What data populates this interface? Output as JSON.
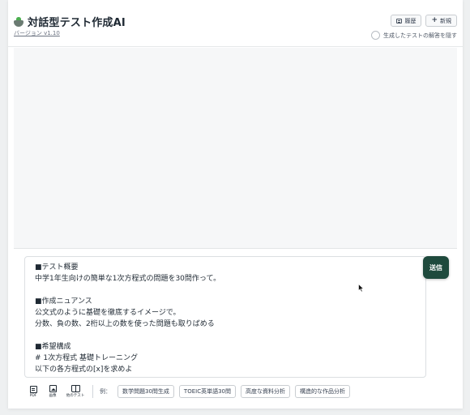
{
  "header": {
    "title": "対話型テスト作成AI",
    "version": "バージョン v1.10",
    "history_label": "履歴",
    "new_label": "新規",
    "hide_answers_label": "生成したテストの解答を隠す"
  },
  "composer": {
    "text": "■テスト概要\n中学1年生向けの簡単な1次方程式の問題を30問作って。\n\n■作成ニュアンス\n公文式のように基礎を徹底するイメージで。\n分数、負の数、2桁以上の数を使った問題も取りばめる\n\n■希望構成\n# 1次方程式 基礎トレーニング\n以下の各方程式の[x]を求めよ"
  },
  "send_label": "送信",
  "toolbar": {
    "tools": [
      {
        "label": "PDF",
        "icon": "pdf-icon"
      },
      {
        "label": "画像",
        "icon": "image-icon"
      },
      {
        "label": "他のテスト",
        "icon": "book-icon"
      }
    ],
    "examples_label": "例：",
    "examples": [
      "数学問題30問生成",
      "TOEIC英単語30問",
      "高度な資料分析",
      "構造的な作品分析"
    ]
  },
  "colors": {
    "send_button": "#1f4a3d",
    "background": "#eef0f1"
  }
}
